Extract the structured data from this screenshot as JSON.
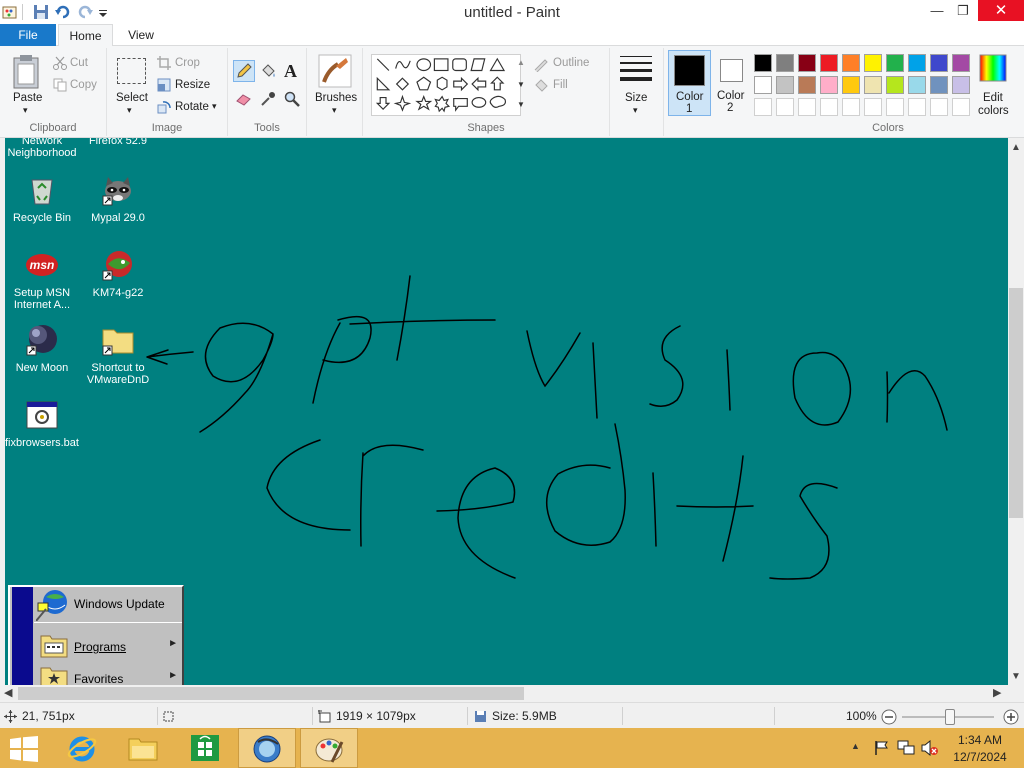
{
  "window": {
    "title": "untitled - Paint",
    "minimize_icon": "—",
    "restore_icon": "❐",
    "close_icon": "✕"
  },
  "tabs": {
    "file": "File",
    "home": "Home",
    "view": "View"
  },
  "ribbon": {
    "clipboard": {
      "label": "Clipboard",
      "paste": "Paste",
      "cut": "Cut",
      "copy": "Copy"
    },
    "image": {
      "label": "Image",
      "select": "Select",
      "crop": "Crop",
      "resize": "Resize",
      "rotate": "Rotate"
    },
    "tools": {
      "label": "Tools"
    },
    "brushes": {
      "label": "Brushes"
    },
    "shapes": {
      "label": "Shapes",
      "outline": "Outline",
      "fill": "Fill"
    },
    "size": {
      "label": "Size"
    },
    "color1": {
      "label1": "Color",
      "label2": "1",
      "value": "#000000"
    },
    "color2": {
      "label1": "Color",
      "label2": "2",
      "value": "#ffffff"
    },
    "colors": {
      "label": "Colors",
      "edit1": "Edit",
      "edit2": "colors",
      "row1": [
        "#000000",
        "#7f7f7f",
        "#880015",
        "#ed1c24",
        "#ff7f27",
        "#fff200",
        "#22b14c",
        "#00a2e8",
        "#3f48cc",
        "#a349a4"
      ],
      "row2": [
        "#ffffff",
        "#c3c3c3",
        "#b97a57",
        "#ffaec9",
        "#ffc90e",
        "#efe4b0",
        "#b5e61d",
        "#99d9ea",
        "#7092be",
        "#c8bfe7"
      ]
    }
  },
  "desktop": {
    "background": "#008080",
    "icons": [
      {
        "name1": "Network",
        "name2": "Neighborhood"
      },
      {
        "name1": "Firefox 52.9",
        "name2": ""
      },
      {
        "name1": "Recycle Bin",
        "name2": ""
      },
      {
        "name1": "Mypal 29.0",
        "name2": ""
      },
      {
        "name1": "Setup MSN",
        "name2": "Internet A..."
      },
      {
        "name1": "KM74-g22",
        "name2": ""
      },
      {
        "name1": "New Moon",
        "name2": ""
      },
      {
        "name1": "Shortcut to",
        "name2": "VMwareDnD"
      },
      {
        "name1": "fixbrowsers.bat",
        "name2": ""
      }
    ],
    "msn_text": "msn"
  },
  "start_menu": {
    "items": [
      {
        "label": "Windows Update"
      },
      {
        "label": "Programs"
      },
      {
        "label": "Favorites"
      }
    ],
    "arrow": "►"
  },
  "status": {
    "position": "21, 751px",
    "dimensions": "1919 × 1079px",
    "size": "Size: 5.9MB",
    "zoom": "100%"
  },
  "clock": {
    "time": "1:34 AM",
    "date": "12/7/2024"
  }
}
